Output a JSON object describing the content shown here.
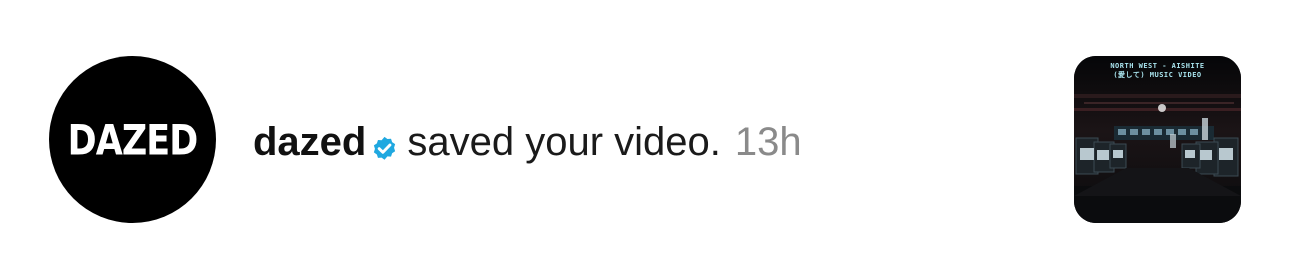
{
  "notification": {
    "avatar_text": "DAZED",
    "username": "dazed",
    "verified_icon": "verified-badge-icon",
    "action": "saved your video.",
    "time": "13h",
    "thumbnail": {
      "caption_line1": "NORTH WEST - AISHITE",
      "caption_line2": "(愛して) MUSIC VIDEO"
    }
  },
  "colors": {
    "verified": "#20a8e0",
    "time": "#8a8a8a",
    "avatar_bg": "#000000"
  }
}
